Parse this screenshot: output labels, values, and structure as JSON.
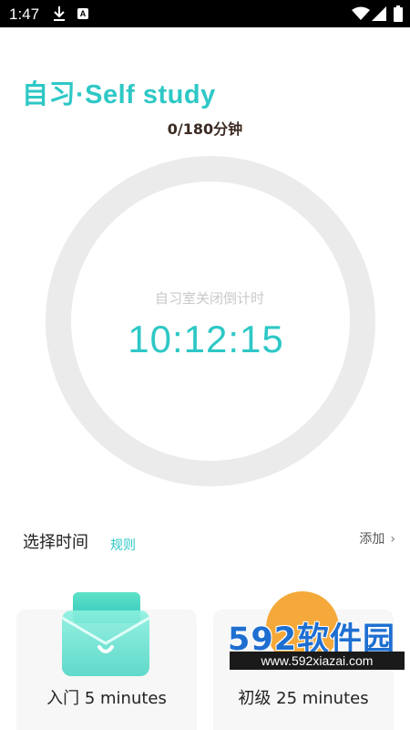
{
  "status_bar": {
    "time": "1:47",
    "download_icon": "download-icon",
    "app_icon": "A",
    "wifi_icon": "wifi-icon",
    "signal_icon": "signal-icon",
    "battery_icon": "battery-icon"
  },
  "header": {
    "title": "自习·Self study",
    "progress": "0/180分钟"
  },
  "timer": {
    "label": "自习室关闭倒计时",
    "time": "10:12:15"
  },
  "select_time": {
    "title": "选择时间",
    "rules_link": "规则",
    "add_link": "添加",
    "add_chevron": "›"
  },
  "cards": [
    {
      "label": "入门  5 minutes",
      "icon": "envelope-icon"
    },
    {
      "label": "初级  25 minutes",
      "icon": "sun-icon"
    }
  ],
  "watermark": {
    "brand": "592软件园",
    "url": "www.592xiazai.com"
  },
  "colors": {
    "accent": "#2ec8c6",
    "ring": "#ebebeb",
    "sun": "#f5a93a",
    "watermark_blue": "#1f6fd1"
  }
}
